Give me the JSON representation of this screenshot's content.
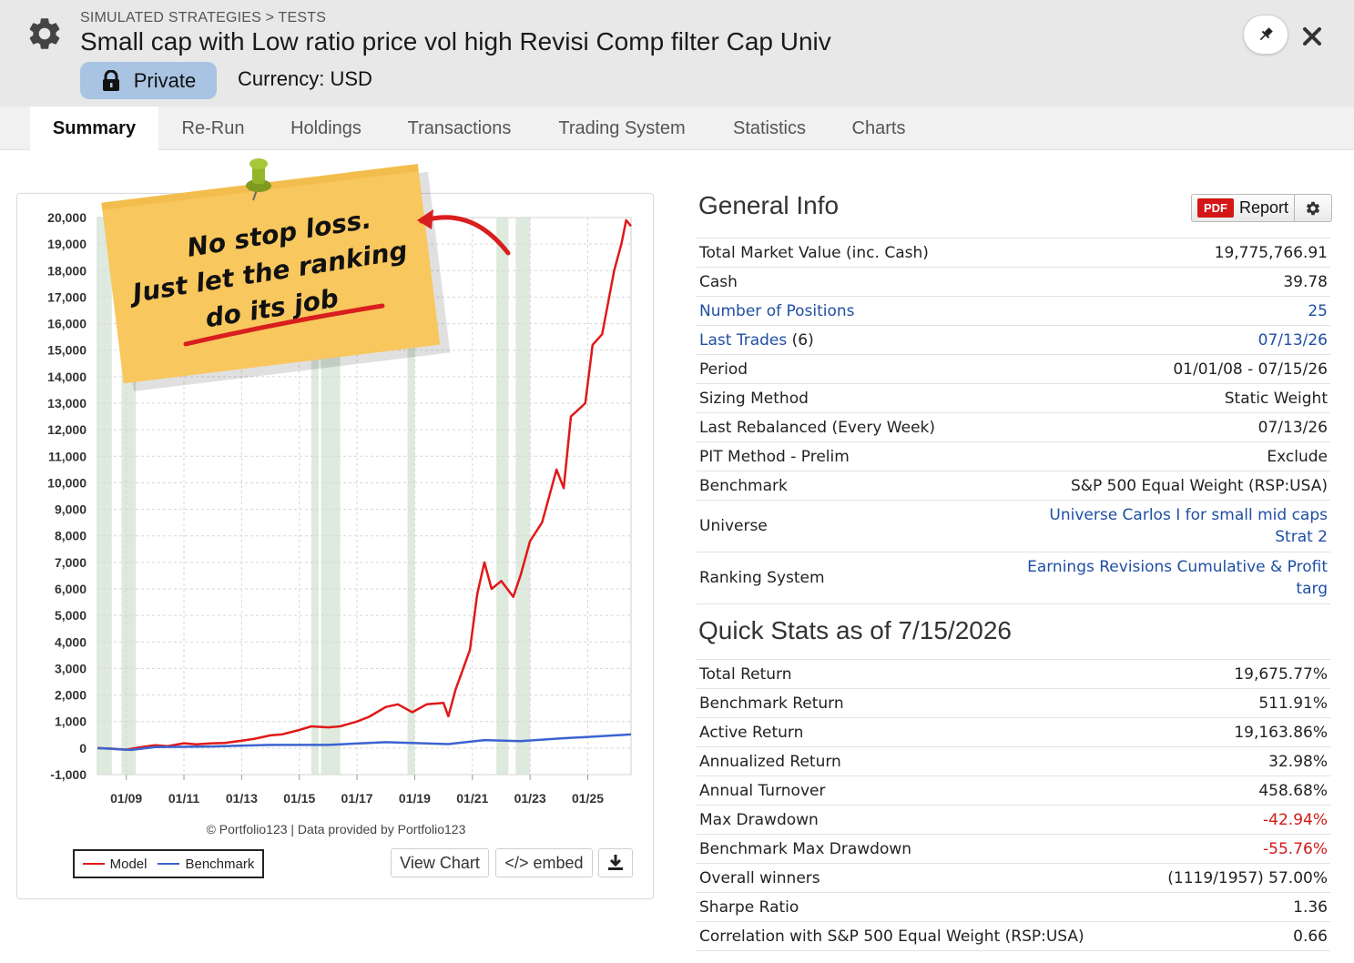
{
  "header": {
    "breadcrumb": "SIMULATED STRATEGIES > TESTS",
    "title": "Small cap with Low ratio price vol high Revisi Comp filter Cap Univ",
    "private_label": "Private",
    "currency_label": "Currency: USD"
  },
  "tabs": [
    "Summary",
    "Re-Run",
    "Holdings",
    "Transactions",
    "Trading System",
    "Statistics",
    "Charts"
  ],
  "active_tab": "Summary",
  "note": {
    "line1": "No stop loss.",
    "line2": "Just let the ranking",
    "line3": "do its job"
  },
  "chart": {
    "credits": "© Portfolio123 | Data provided by Portfolio123",
    "legend_model": "Model",
    "legend_benchmark": "Benchmark",
    "view_chart_label": "View Chart",
    "embed_label": "</> embed"
  },
  "chart_data": {
    "type": "line",
    "title": "",
    "xlabel": "",
    "ylabel": "",
    "ylim": [
      -1000,
      20000
    ],
    "y_ticks": [
      "20,000",
      "19,000",
      "18,000",
      "17,000",
      "16,000",
      "15,000",
      "14,000",
      "13,000",
      "12,000",
      "11,000",
      "10,000",
      "9,000",
      "8,000",
      "7,000",
      "6,000",
      "5,000",
      "4,000",
      "3,000",
      "2,000",
      "1,000",
      "0",
      "-1,000"
    ],
    "x_ticks": [
      "01/09",
      "01/11",
      "01/13",
      "01/15",
      "01/17",
      "01/19",
      "01/21",
      "01/23",
      "01/25"
    ],
    "xlim": [
      "2008-01",
      "2026-07"
    ],
    "colors": {
      "model": "#e01818",
      "benchmark": "#3b63d1",
      "shading": "#d9e8d9"
    },
    "series": [
      {
        "name": "Model",
        "points": [
          [
            "2008-01",
            0
          ],
          [
            "2008-06",
            -20
          ],
          [
            "2009-01",
            -60
          ],
          [
            "2009-06",
            20
          ],
          [
            "2010-01",
            110
          ],
          [
            "2010-06",
            70
          ],
          [
            "2011-01",
            180
          ],
          [
            "2011-06",
            140
          ],
          [
            "2012-01",
            180
          ],
          [
            "2012-06",
            190
          ],
          [
            "2013-01",
            280
          ],
          [
            "2013-06",
            340
          ],
          [
            "2014-01",
            480
          ],
          [
            "2014-06",
            520
          ],
          [
            "2015-01",
            680
          ],
          [
            "2015-06",
            820
          ],
          [
            "2016-01",
            780
          ],
          [
            "2016-06",
            820
          ],
          [
            "2017-01",
            1000
          ],
          [
            "2017-06",
            1180
          ],
          [
            "2018-01",
            1550
          ],
          [
            "2018-06",
            1650
          ],
          [
            "2018-12",
            1350
          ],
          [
            "2019-06",
            1650
          ],
          [
            "2020-01",
            1700
          ],
          [
            "2020-03",
            1200
          ],
          [
            "2020-06",
            2200
          ],
          [
            "2020-12",
            3700
          ],
          [
            "2021-03",
            5800
          ],
          [
            "2021-06",
            7000
          ],
          [
            "2021-09",
            6000
          ],
          [
            "2022-01",
            6300
          ],
          [
            "2022-06",
            5700
          ],
          [
            "2022-09",
            6500
          ],
          [
            "2023-01",
            7800
          ],
          [
            "2023-06",
            8500
          ],
          [
            "2023-12",
            10500
          ],
          [
            "2024-03",
            9800
          ],
          [
            "2024-06",
            12500
          ],
          [
            "2024-12",
            13000
          ],
          [
            "2025-03",
            15200
          ],
          [
            "2025-07",
            15600
          ],
          [
            "2025-12",
            18000
          ],
          [
            "2026-03",
            19000
          ],
          [
            "2026-05",
            19900
          ],
          [
            "2026-07",
            19675
          ]
        ]
      },
      {
        "name": "Benchmark",
        "points": [
          [
            "2008-01",
            0
          ],
          [
            "2009-03",
            -70
          ],
          [
            "2010-01",
            40
          ],
          [
            "2012-01",
            60
          ],
          [
            "2014-01",
            120
          ],
          [
            "2016-01",
            120
          ],
          [
            "2018-01",
            220
          ],
          [
            "2020-03",
            150
          ],
          [
            "2021-06",
            300
          ],
          [
            "2022-09",
            260
          ],
          [
            "2024-01",
            360
          ],
          [
            "2026-07",
            512
          ]
        ]
      }
    ],
    "shaded_periods": [
      [
        "2008-01",
        "2008-07"
      ],
      [
        "2008-11",
        "2009-05"
      ],
      [
        "2015-06",
        "2015-09"
      ],
      [
        "2015-10",
        "2016-06"
      ],
      [
        "2018-10",
        "2019-01"
      ],
      [
        "2021-11",
        "2022-04"
      ],
      [
        "2022-07",
        "2023-01"
      ]
    ]
  },
  "general_info": {
    "title": "General Info",
    "report_pdf": "PDF",
    "report_label": "Report",
    "rows": [
      {
        "key": "Total Market Value (inc. Cash)",
        "value": "19,775,766.91"
      },
      {
        "key": "Cash",
        "value": "39.78"
      },
      {
        "key": "Number of Positions",
        "value": "25"
      },
      {
        "key": "Last Trades",
        "key_extra": " (6)",
        "value": "07/13/26"
      },
      {
        "key": "Period",
        "value": "01/01/08 - 07/15/26"
      },
      {
        "key": "Sizing Method",
        "value": "Static Weight"
      },
      {
        "key": "Last Rebalanced (Every Week)",
        "value": "07/13/26"
      },
      {
        "key": "PIT Method - Prelim",
        "value": "Exclude"
      },
      {
        "key": "Benchmark",
        "value": "S&P 500 Equal Weight (RSP:USA)"
      },
      {
        "key": "Universe",
        "value_line1": "Universe Carlos I for small mid caps",
        "value_line2": "Strat 2"
      },
      {
        "key": "Ranking System",
        "value_line1": "Earnings Revisions Cumulative & Profit",
        "value_line2": "targ"
      }
    ]
  },
  "quick_stats": {
    "title": "Quick Stats as of 7/15/2026",
    "rows": [
      {
        "key": "Total Return",
        "value": "19,675.77%"
      },
      {
        "key": "Benchmark Return",
        "value": "511.91%"
      },
      {
        "key": "Active Return",
        "value": "19,163.86%"
      },
      {
        "key": "Annualized Return",
        "value": "32.98%"
      },
      {
        "key": "Annual Turnover",
        "value": "458.68%"
      },
      {
        "key": "Max Drawdown",
        "value": "-42.94%"
      },
      {
        "key": "Benchmark Max Drawdown",
        "value": "-55.76%"
      },
      {
        "key": "Overall winners",
        "value": "(1119/1957) 57.00%"
      },
      {
        "key": "Sharpe Ratio",
        "value": "1.36"
      },
      {
        "key": "Correlation with S&P 500 Equal Weight (RSP:USA)",
        "value": "0.66"
      }
    ]
  }
}
